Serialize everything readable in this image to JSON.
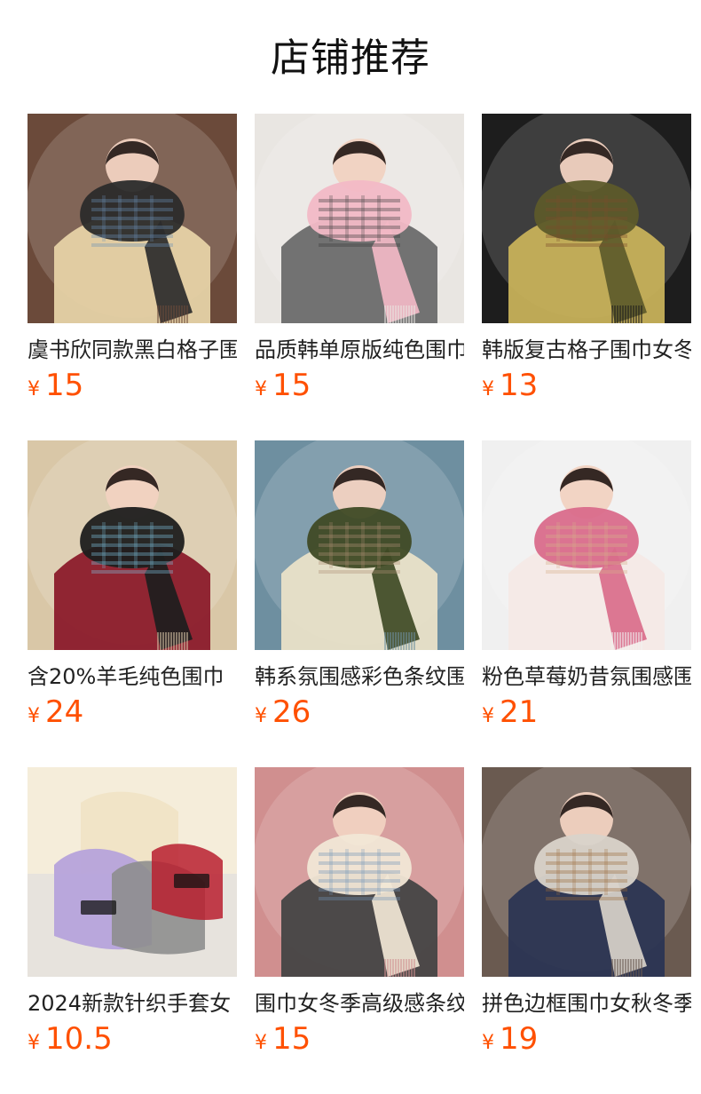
{
  "header": {
    "title": "店铺推荐"
  },
  "currency_symbol": "¥",
  "products": [
    {
      "name": "虞书欣同款黑白格子围巾",
      "price": "15",
      "icon": "scarf-photo",
      "colors": [
        "#2b2b2b",
        "#e6d2a6",
        "#6b4a3a",
        "#6a8fb8"
      ]
    },
    {
      "name": "品质韩单原版纯色围巾",
      "price": "15",
      "icon": "scarf-photo",
      "colors": [
        "#f2b9c6",
        "#6b6b6b",
        "#e9e6e2",
        "#3a3a3a"
      ]
    },
    {
      "name": "韩版复古格子围巾女冬",
      "price": "13",
      "icon": "scarf-photo",
      "colors": [
        "#5d5a2a",
        "#c7b15a",
        "#1d1d1d",
        "#7a4a2a"
      ]
    },
    {
      "name": "含20%羊毛纯色围巾",
      "price": "24",
      "icon": "scarf-photo",
      "colors": [
        "#1d1d1d",
        "#8b1b2b",
        "#d9c7a7",
        "#7fc3df"
      ]
    },
    {
      "name": "韩系氛围感彩色条纹围巾",
      "price": "26",
      "icon": "scarf-photo",
      "colors": [
        "#3f4a25",
        "#e9e1c8",
        "#6e8fa0",
        "#b08f75"
      ]
    },
    {
      "name": "粉色草莓奶昔氛围感围巾",
      "price": "21",
      "icon": "scarf-photo",
      "colors": [
        "#d96c8b",
        "#f4e9e6",
        "#f0f0f0",
        "#d8b08a"
      ]
    },
    {
      "name": "2024新款针织手套女",
      "price": "10.5",
      "icon": "gloves-photo",
      "colors": [
        "#b6a3db",
        "#8e8e8e",
        "#f0e4c6",
        "#b91f2f"
      ]
    },
    {
      "name": "围巾女冬季高级感条纹",
      "price": "15",
      "icon": "scarf-photo",
      "colors": [
        "#f1e7d6",
        "#444444",
        "#d08f8f",
        "#6f93b7"
      ]
    },
    {
      "name": "拼色边框围巾女秋冬季",
      "price": "19",
      "icon": "scarf-photo",
      "colors": [
        "#d9d3ca",
        "#2b3553",
        "#6a5a50",
        "#9b6b3a"
      ]
    }
  ]
}
